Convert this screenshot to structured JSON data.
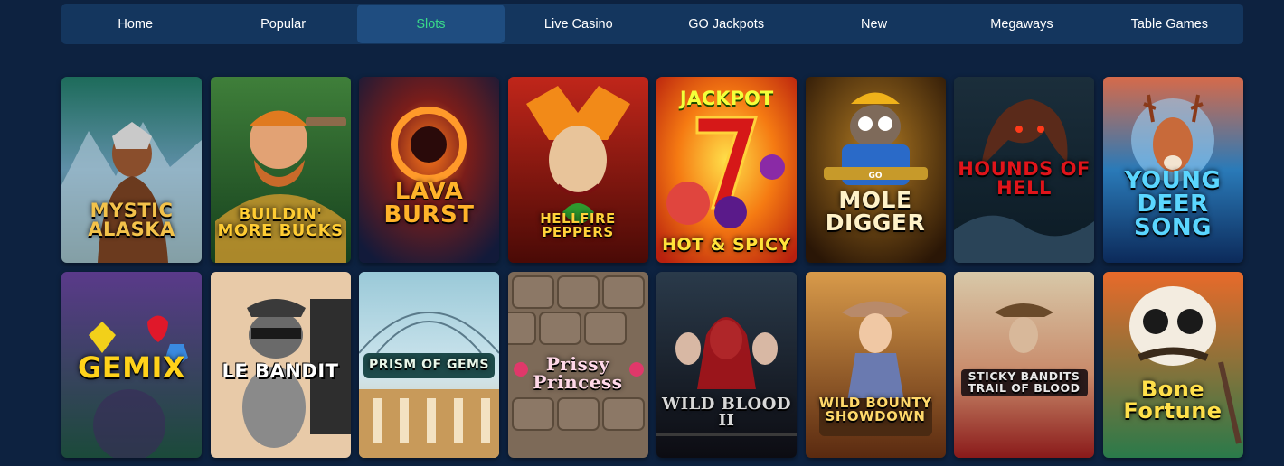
{
  "nav": {
    "tabs": [
      {
        "label": "Home",
        "active": false
      },
      {
        "label": "Popular",
        "active": false
      },
      {
        "label": "Slots",
        "active": true
      },
      {
        "label": "Live Casino",
        "active": false
      },
      {
        "label": "GO Jackpots",
        "active": false
      },
      {
        "label": "New",
        "active": false
      },
      {
        "label": "Megaways",
        "active": false
      },
      {
        "label": "Table Games",
        "active": false
      }
    ],
    "active_color": "#39d98a"
  },
  "games": [
    {
      "title": "MYSTIC ALASKA"
    },
    {
      "title": "BUILDIN' MORE BUCKS"
    },
    {
      "title": "LAVA BURST"
    },
    {
      "title": "HELLFIRE PEPPERS"
    },
    {
      "title": "HOT & SPICY",
      "tag": "JACKPOT"
    },
    {
      "title": "MOLE DIGGER",
      "tag": "GO"
    },
    {
      "title": "HOUNDS OF HELL"
    },
    {
      "title": "YOUNG DEER SONG"
    },
    {
      "title": "GEMIX"
    },
    {
      "title": "LE BANDIT"
    },
    {
      "title": "PRISM OF GEMS"
    },
    {
      "title": "Prissy Princess"
    },
    {
      "title": "WILD BLOOD II"
    },
    {
      "title": "WILD BOUNTY SHOWDOWN"
    },
    {
      "title": "STICKY BANDITS TRAIL OF BLOOD"
    },
    {
      "title": "Bone Fortune"
    }
  ]
}
